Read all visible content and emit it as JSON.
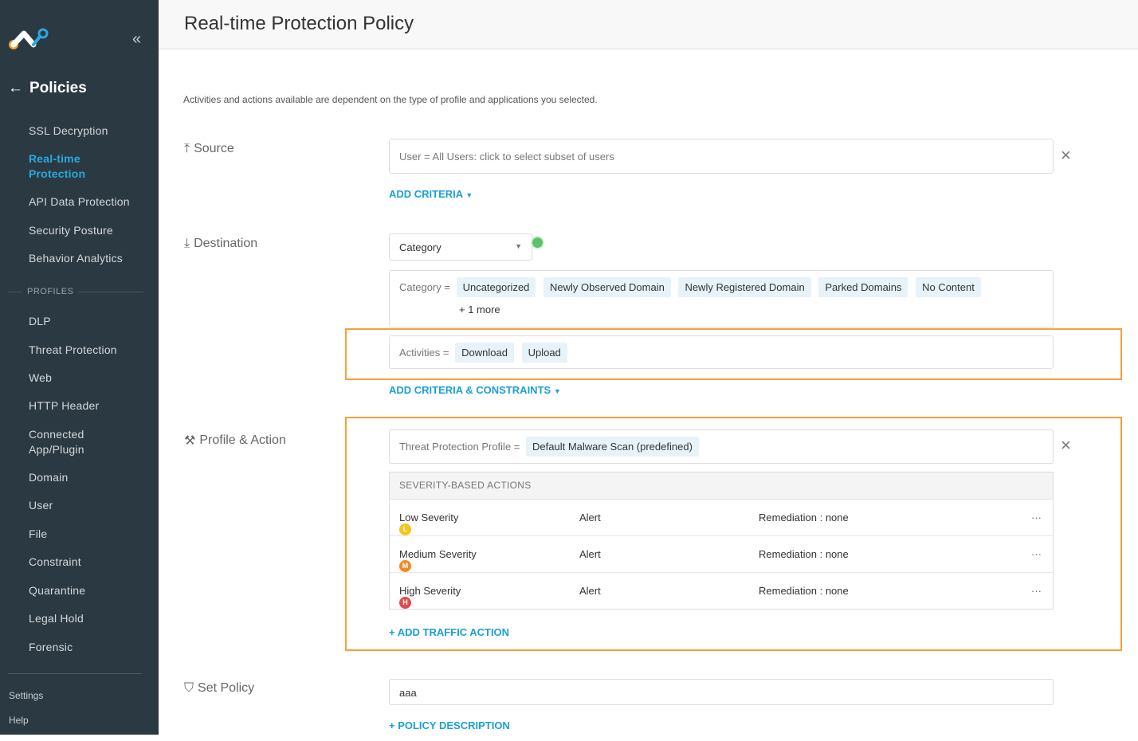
{
  "sidebar": {
    "back_label": "Policies",
    "nav": [
      "SSL Decryption",
      "Real-time Protection",
      "API Data Protection",
      "Security Posture",
      "Behavior Analytics"
    ],
    "profiles_label": "PROFILES",
    "profiles": [
      "DLP",
      "Threat Protection",
      "Web",
      "HTTP Header",
      "Connected App/Plugin",
      "Domain",
      "User",
      "File",
      "Constraint",
      "Quarantine",
      "Legal Hold",
      "Forensic"
    ],
    "settings": "Settings",
    "help": "Help"
  },
  "header": {
    "title": "Real-time Protection Policy"
  },
  "intro": "Activities and actions available are dependent on the type of profile and applications you selected.",
  "source": {
    "title": "Source",
    "field": "User = All Users: click to select subset of users",
    "add": "ADD CRITERIA"
  },
  "destination": {
    "title": "Destination",
    "select": "Category",
    "cat_label": "Category =",
    "chips": [
      "Uncategorized",
      "Newly Observed Domain",
      "Newly Registered Domain",
      "Parked Domains",
      "No Content"
    ],
    "more": "+ 1 more",
    "act_label": "Activities =",
    "activities": [
      "Download",
      "Upload"
    ],
    "add": "ADD CRITERIA & CONSTRAINTS"
  },
  "profile": {
    "title": "Profile & Action",
    "label": "Threat Protection Profile =",
    "value": "Default Malware Scan (predefined)",
    "sev_header": "SEVERITY-BASED ACTIONS",
    "rows": [
      {
        "badge": "L",
        "name": "Low Severity",
        "action": "Alert",
        "remediation": "Remediation : none",
        "color": "#f5c518"
      },
      {
        "badge": "M",
        "name": "Medium Severity",
        "action": "Alert",
        "remediation": "Remediation : none",
        "color": "#f08a24"
      },
      {
        "badge": "H",
        "name": "High Severity",
        "action": "Alert",
        "remediation": "Remediation : none",
        "color": "#e5484d"
      }
    ],
    "more_icon": "···",
    "add": "+ ADD TRAFFIC ACTION"
  },
  "set_policy": {
    "title": "Set Policy",
    "name": "aaa",
    "add": "+ POLICY DESCRIPTION"
  },
  "colors": {
    "accent": "#1a9fd8",
    "highlight": "#f5a13a",
    "sidebar": "#2b3942"
  }
}
